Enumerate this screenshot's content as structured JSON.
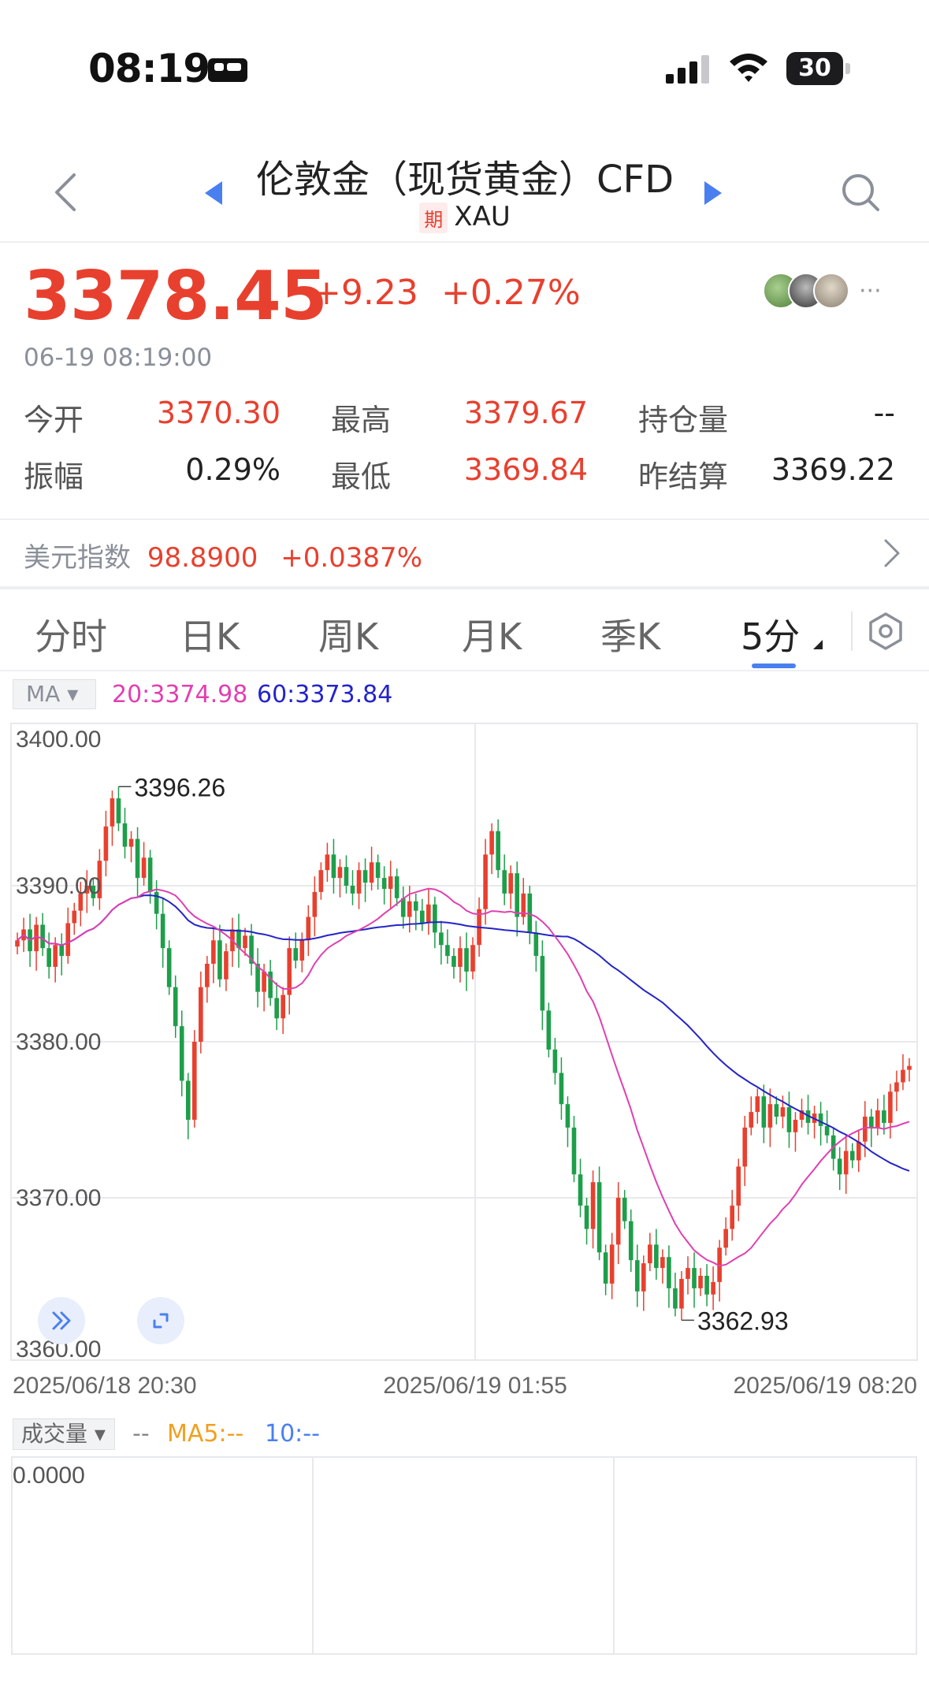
{
  "status_bar": {
    "time": "08:19",
    "battery": "30"
  },
  "header": {
    "title": "伦敦金（现货黄金）CFD",
    "period_badge": "期",
    "symbol": "XAU"
  },
  "quote": {
    "price": "3378.45",
    "change": "+9.23",
    "change_pct": "+0.27%",
    "timestamp": "06-19 08:19:00",
    "more": "···"
  },
  "stats": [
    {
      "label": "今开",
      "value": "3370.30",
      "color": "#e8402f"
    },
    {
      "label": "最高",
      "value": "3379.67",
      "color": "#e8402f"
    },
    {
      "label": "持仓量",
      "value": "--",
      "color": "#222222"
    },
    {
      "label": "振幅",
      "value": "0.29%",
      "color": "#222222"
    },
    {
      "label": "最低",
      "value": "3369.84",
      "color": "#e8402f"
    },
    {
      "label": "昨结算",
      "value": "3369.22",
      "color": "#222222"
    }
  ],
  "usd_index": {
    "label": "美元指数",
    "value": "98.8900",
    "change": "+0.0387%"
  },
  "tabs": [
    {
      "label": "分时",
      "active": false
    },
    {
      "label": "日K",
      "active": false
    },
    {
      "label": "周K",
      "active": false
    },
    {
      "label": "月K",
      "active": false
    },
    {
      "label": "季K",
      "active": false
    },
    {
      "label": "5分",
      "active": true
    }
  ],
  "ma_legend": {
    "selector": "MA",
    "ma20": "20:3374.98",
    "ma60": "60:3373.84"
  },
  "colors": {
    "up": "#e8402f",
    "down": "#1e9e4a",
    "ma20": "#e040b0",
    "ma60": "#2424c8",
    "accent": "#4a7ff0"
  },
  "chart_data": {
    "type": "candlestick",
    "interval": "5分",
    "y_ticks": [
      "3400.00",
      "3390.00",
      "3380.00",
      "3370.00",
      "3360.00"
    ],
    "ylim": [
      3360,
      3400
    ],
    "x_labels": [
      "2025/06/18 20:30",
      "2025/06/19 01:55",
      "2025/06/19 08:20"
    ],
    "high_annotation": "3396.26",
    "low_annotation": "3362.93",
    "ma20_last": 3374.98,
    "ma60_last": 3373.84,
    "closes": [
      3386.5,
      3387.2,
      3385.8,
      3387.5,
      3386.0,
      3384.8,
      3386.2,
      3385.5,
      3387.6,
      3388.4,
      3389.5,
      3390.0,
      3389.2,
      3391.6,
      3393.8,
      3395.6,
      3394.0,
      3392.5,
      3393.0,
      3390.5,
      3391.8,
      3389.6,
      3388.2,
      3386.0,
      3383.5,
      3381.0,
      3377.5,
      3375.0,
      3380.0,
      3383.5,
      3385.0,
      3386.5,
      3384.0,
      3385.8,
      3387.2,
      3386.0,
      3386.8,
      3385.0,
      3383.2,
      3384.5,
      3382.8,
      3381.5,
      3383.0,
      3386.0,
      3385.2,
      3386.5,
      3388.0,
      3389.6,
      3391.0,
      3392.0,
      3390.5,
      3391.2,
      3390.0,
      3389.5,
      3391.0,
      3390.2,
      3391.5,
      3390.5,
      3389.8,
      3390.6,
      3389.2,
      3388.0,
      3389.0,
      3388.4,
      3387.6,
      3388.8,
      3387.0,
      3386.2,
      3385.5,
      3384.8,
      3386.0,
      3384.5,
      3386.2,
      3388.5,
      3392.0,
      3393.5,
      3391.0,
      3389.5,
      3390.8,
      3388.0,
      3389.5,
      3387.0,
      3385.5,
      3382.0,
      3379.5,
      3378.0,
      3376.0,
      3374.5,
      3371.5,
      3369.5,
      3368.0,
      3371.0,
      3366.5,
      3364.5,
      3367.0,
      3370.0,
      3368.5,
      3366.0,
      3364.0,
      3365.8,
      3367.0,
      3365.5,
      3366.2,
      3364.2,
      3362.9,
      3364.8,
      3365.5,
      3364.2,
      3365.0,
      3363.8,
      3364.6,
      3366.8,
      3368.0,
      3369.5,
      3372.0,
      3374.5,
      3375.5,
      3376.5,
      3374.5,
      3376.0,
      3375.2,
      3375.8,
      3374.2,
      3375.0,
      3375.6,
      3374.8,
      3375.4,
      3374.6,
      3374.0,
      3372.5,
      3371.5,
      3373.0,
      3372.4,
      3373.6,
      3375.2,
      3374.5,
      3375.6,
      3374.8,
      3376.8,
      3377.4,
      3378.2,
      3378.45
    ]
  },
  "volume": {
    "selector": "成交量",
    "value_dash": "--",
    "ma5": "MA5:--",
    "ma10": "10:--",
    "zero": "0.0000"
  }
}
